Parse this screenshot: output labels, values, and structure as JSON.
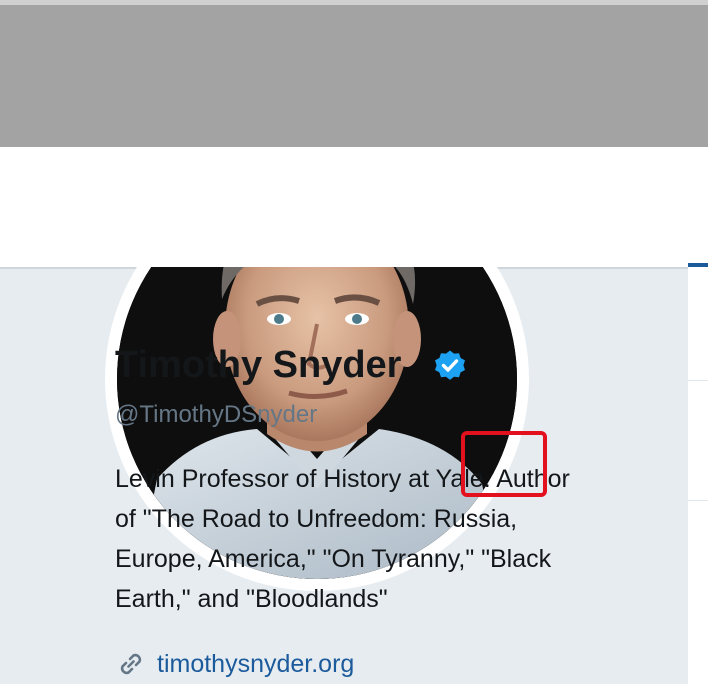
{
  "profile": {
    "name": "Timothy Snyder",
    "handle": "@TimothyDSnyder",
    "verified_icon": "verified-badge-icon",
    "bio_lines": [
      "Levin Professor of History at Yale. Author",
      "of \"The Road to Unfreedom: Russia,",
      "Europe, America,\" \"On Tyranny,\" \"Black",
      "Earth,\" and \"Bloodlands\""
    ],
    "website": "timothysnyder.org",
    "link_icon": "link-icon"
  },
  "colors": {
    "banner": "#a3a3a3",
    "card": "#e6ecf0",
    "link": "#1b5a9b",
    "verified": "#1da1f2",
    "highlight": "#e3101e"
  }
}
